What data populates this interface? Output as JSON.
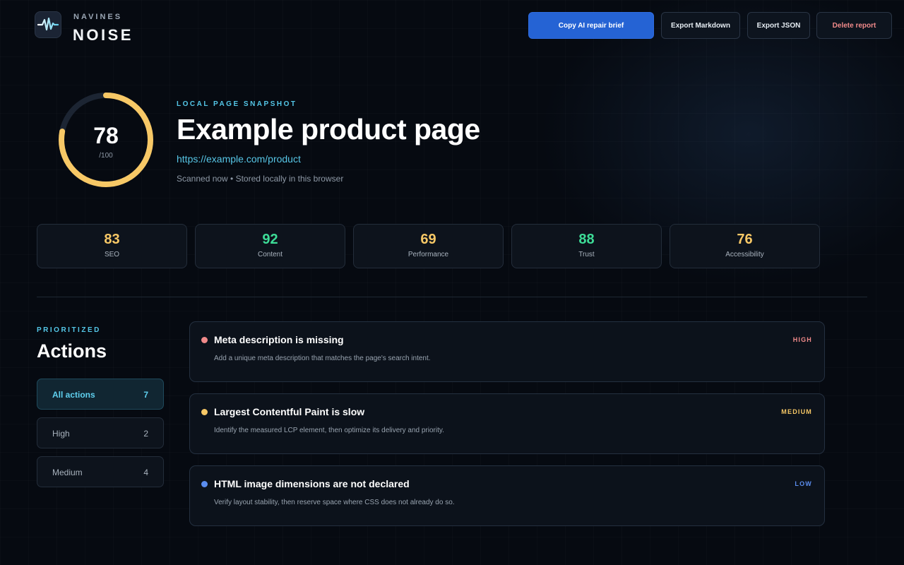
{
  "brand": {
    "top": "NAVINES",
    "main": "NOISE",
    "logo_icon": "waveform-icon"
  },
  "toolbar": {
    "copy_label": "Copy AI repair brief",
    "export_md_label": "Export Markdown",
    "export_json_label": "Export JSON",
    "delete_label": "Delete report"
  },
  "colors": {
    "accent_blue": "#2563d4",
    "cyan": "#54c7e8",
    "score_yellow": "#f7c866",
    "score_green": "#3ddc97",
    "high_red": "#f08a8a",
    "medium_yellow": "#f7c866",
    "low_blue": "#5b8def"
  },
  "hero": {
    "score": "78",
    "score_max": "/100",
    "score_fraction": 0.78,
    "eyebrow": "LOCAL PAGE SNAPSHOT",
    "title": "Example product page",
    "url": "https://example.com/product",
    "meta": "Scanned now • Stored locally in this browser"
  },
  "metrics": [
    {
      "value": "83",
      "label": "SEO",
      "color": "#f7c866"
    },
    {
      "value": "92",
      "label": "Content",
      "color": "#3ddc97"
    },
    {
      "value": "69",
      "label": "Performance",
      "color": "#f7c866"
    },
    {
      "value": "88",
      "label": "Trust",
      "color": "#3ddc97"
    },
    {
      "value": "76",
      "label": "Accessibility",
      "color": "#f7c866"
    }
  ],
  "actions": {
    "eyebrow": "PRIORITIZED",
    "title": "Actions",
    "filters": [
      {
        "label": "All actions",
        "count": "7",
        "active": true
      },
      {
        "label": "High",
        "count": "2",
        "active": false
      },
      {
        "label": "Medium",
        "count": "4",
        "active": false
      }
    ],
    "items": [
      {
        "title": "Meta description is missing",
        "description": "Add a unique meta description that matches the page's search intent.",
        "priority": "HIGH",
        "color": "#f08a8a"
      },
      {
        "title": "Largest Contentful Paint is slow",
        "description": "Identify the measured LCP element, then optimize its delivery and priority.",
        "priority": "MEDIUM",
        "color": "#f7c866"
      },
      {
        "title": "HTML image dimensions are not declared",
        "description": "Verify layout stability, then reserve space where CSS does not already do so.",
        "priority": "LOW",
        "color": "#5b8def"
      }
    ]
  }
}
